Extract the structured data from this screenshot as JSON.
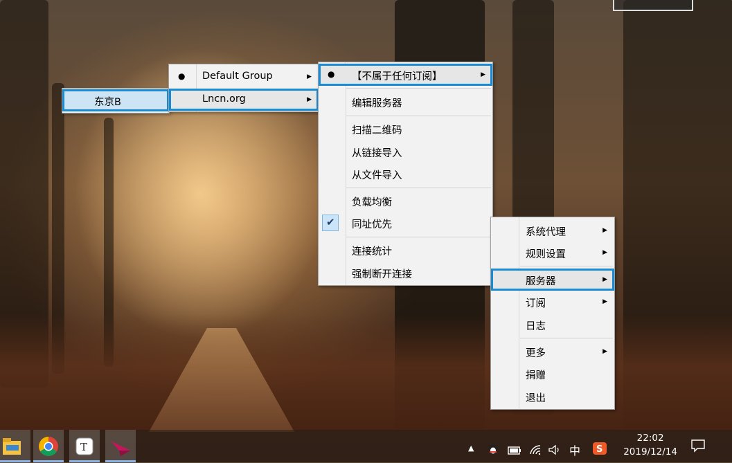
{
  "menus": {
    "location_menu": {
      "items": [
        {
          "label": "东京B"
        }
      ]
    },
    "group_menu": {
      "items": [
        {
          "label": "Default Group"
        },
        {
          "label": "Lncn.org"
        }
      ]
    },
    "server_menu": {
      "items": [
        {
          "label": "【不属于任何订阅】"
        },
        {
          "label": "编辑服务器"
        },
        {
          "label": "扫描二维码"
        },
        {
          "label": "从链接导入"
        },
        {
          "label": "从文件导入"
        },
        {
          "label": "负载均衡"
        },
        {
          "label": "同址优先"
        },
        {
          "label": "连接统计"
        },
        {
          "label": "强制断开连接"
        }
      ]
    },
    "main_menu": {
      "items": [
        {
          "label": "系统代理"
        },
        {
          "label": "规则设置"
        },
        {
          "label": "服务器"
        },
        {
          "label": "订阅"
        },
        {
          "label": "日志"
        },
        {
          "label": "更多"
        },
        {
          "label": "捐赠"
        },
        {
          "label": "退出"
        }
      ]
    }
  },
  "taskbar": {
    "apps": [
      "file-explorer-icon",
      "chrome-icon",
      "typora-icon",
      "paper-plane-icon"
    ],
    "ime": "中",
    "clock": {
      "time": "22:02",
      "date": "2019/12/14"
    }
  },
  "colors": {
    "highlight": "#1a8ad2",
    "menu_bg": "#f2f2f2"
  }
}
